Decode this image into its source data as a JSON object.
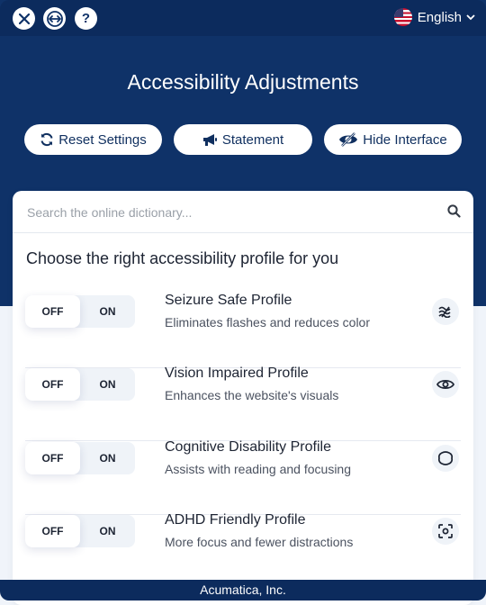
{
  "header": {
    "buttons": [
      {
        "name": "close",
        "icon": "close-icon"
      },
      {
        "name": "resize",
        "icon": "arrows-horizontal-icon"
      },
      {
        "name": "help",
        "icon": "question-icon",
        "glyph": "?"
      }
    ],
    "language": {
      "label": "English",
      "icon": "us-flag-icon"
    },
    "title": "Accessibility Adjustments",
    "actions": [
      {
        "label": "Reset Settings",
        "icon": "refresh-icon"
      },
      {
        "label": "Statement",
        "icon": "megaphone-icon"
      },
      {
        "label": "Hide Interface",
        "icon": "eye-slash-icon"
      }
    ]
  },
  "search": {
    "placeholder": "Search the online dictionary...",
    "icon": "search-icon"
  },
  "profiles": {
    "heading": "Choose the right accessibility profile for you",
    "items": [
      {
        "name": "Seizure Safe Profile",
        "description": "Eliminates flashes and reduces color",
        "off": "OFF",
        "on": "ON",
        "state": "off",
        "icon": "waves-icon"
      },
      {
        "name": "Vision Impaired Profile",
        "description": "Enhances the website's visuals",
        "off": "OFF",
        "on": "ON",
        "state": "off",
        "icon": "eye-icon"
      },
      {
        "name": "Cognitive Disability Profile",
        "description": "Assists with reading and focusing",
        "off": "OFF",
        "on": "ON",
        "state": "off",
        "icon": "brain-icon"
      },
      {
        "name": "ADHD Friendly Profile",
        "description": "More focus and fewer distractions",
        "off": "OFF",
        "on": "ON",
        "state": "off",
        "icon": "focus-icon"
      }
    ]
  },
  "footer": {
    "text": "Acumatica, Inc."
  },
  "colors": {
    "navy": "#0f3268",
    "navy_dark": "#0c2b5d",
    "background": "#f0f4fa",
    "text": "#1d2433"
  }
}
